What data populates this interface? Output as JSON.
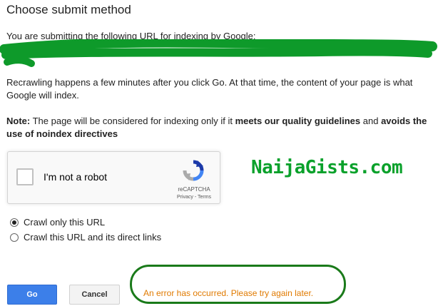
{
  "header": {
    "title": "Choose submit method"
  },
  "submission": {
    "intro": "You are submitting the following URL for indexing by Google:"
  },
  "info": {
    "recrawl_line1": "Recrawling happens a few minutes after you click Go. At that time, the content of your page is what",
    "recrawl_line2": "Google will index."
  },
  "note": {
    "label": "Note:",
    "text1": " The page will be considered for indexing only if it ",
    "bold1": "meets our quality guidelines",
    "text2": " and ",
    "bold2a": "avoids the",
    "bold2b": "use of noindex directives"
  },
  "recaptcha": {
    "label": "I'm not a robot",
    "brand": "reCAPTCHA",
    "privacy": "Privacy",
    "separator": " - ",
    "terms": "Terms",
    "checked": false
  },
  "watermark": "NaijaGists.com",
  "crawl_options": [
    {
      "label": "Crawl only this URL",
      "selected": true
    },
    {
      "label": "Crawl this URL and its direct links",
      "selected": false
    }
  ],
  "buttons": {
    "go": "Go",
    "cancel": "Cancel"
  },
  "error": {
    "message": "An error has occurred. Please try again later.",
    "color": "#e07a00"
  },
  "colors": {
    "accent": "#3c7fe9",
    "highlight": "#1a7a1a",
    "watermark": "#0aa12b"
  }
}
